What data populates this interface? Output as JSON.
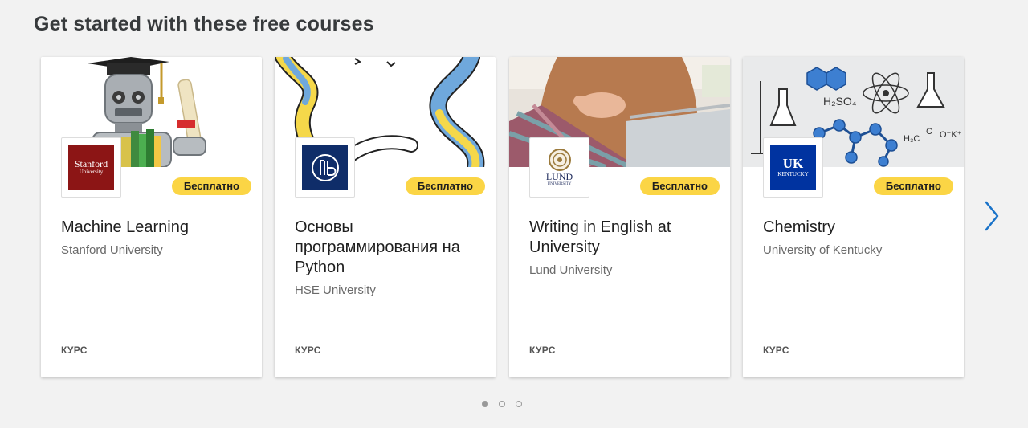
{
  "section": {
    "title": "Get started with these free courses"
  },
  "courses": [
    {
      "title": "Machine Learning",
      "partner": "Stanford University",
      "badge": "Бесплатно",
      "type": "КУРС",
      "logo_text_1": "Stanford",
      "logo_text_2": "University",
      "logo_color": "#8c1515"
    },
    {
      "title": "Основы программирования на Python",
      "partner": "HSE University",
      "badge": "Бесплатно",
      "type": "КУРС",
      "logo_color": "#0f2d69"
    },
    {
      "title": "Writing in English at University",
      "partner": "Lund University",
      "badge": "Бесплатно",
      "type": "КУРС",
      "logo_text_1": "LUND",
      "logo_text_2": "UNIVERSITY",
      "logo_color": "#9b7a3c"
    },
    {
      "title": "Chemistry",
      "partner": "University of Kentucky",
      "badge": "Бесплатно",
      "type": "КУРС",
      "logo_text_1": "UK",
      "logo_text_2": "KENTUCKY",
      "logo_color": "#0033a0"
    }
  ],
  "carousel": {
    "next_icon": "chevron-right-icon",
    "page_count": 3,
    "active_page": 1
  },
  "colors": {
    "accent": "#0056d2",
    "badge": "#fbd545",
    "background": "#f2f2f2"
  }
}
